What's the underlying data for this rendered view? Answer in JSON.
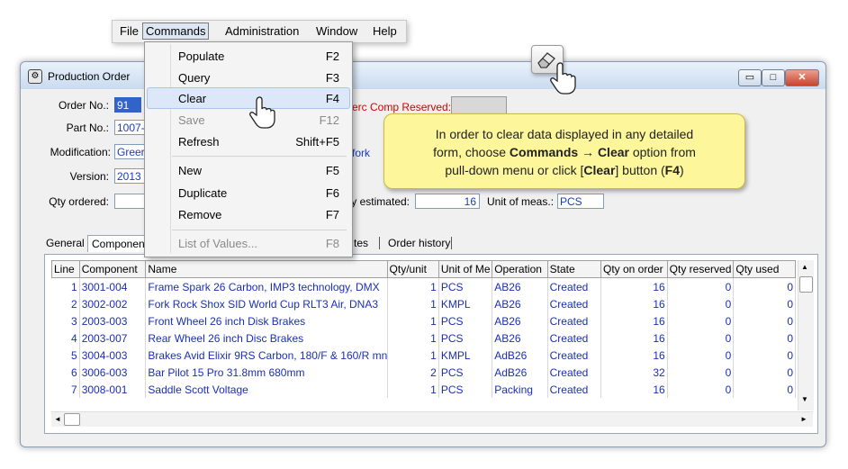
{
  "menubar": {
    "items": [
      "File",
      "Commands",
      "Administration",
      "Window",
      "Help"
    ],
    "active": "Commands"
  },
  "commands_menu": {
    "items": [
      {
        "label": "Populate",
        "shortcut": "F2",
        "enabled": true
      },
      {
        "label": "Query",
        "shortcut": "F3",
        "enabled": true
      },
      {
        "label": "Clear",
        "shortcut": "F4",
        "enabled": true,
        "highlighted": true
      },
      {
        "label": "Save",
        "shortcut": "F12",
        "enabled": false
      },
      {
        "label": "Refresh",
        "shortcut": "Shift+F5",
        "enabled": true
      },
      {
        "label": "New",
        "shortcut": "F5",
        "enabled": true
      },
      {
        "label": "Duplicate",
        "shortcut": "F6",
        "enabled": true
      },
      {
        "label": "Remove",
        "shortcut": "F7",
        "enabled": true
      },
      {
        "label": "List of Values...",
        "shortcut": "F8",
        "enabled": false
      }
    ]
  },
  "window": {
    "title": "Production Order",
    "min_glyph": "▭",
    "max_glyph": "□",
    "close_glyph": "✕"
  },
  "form": {
    "order_no_label": "Order No.:",
    "order_no_value": "91",
    "part_no_label": "Part No.:",
    "part_no_value": "1007-",
    "modification_label": "Modification:",
    "modification_value": "Greer",
    "version_label": "Version:",
    "version_value": "2013",
    "qty_ordered_label": "Qty ordered:",
    "qty_ordered_value": "",
    "perc_comp_label": "erc Comp Reserved:",
    "fork_value": "fork",
    "qty_estimated_label": "ty estimated:",
    "qty_estimated_value": "16",
    "unit_label": "Unit of meas.:",
    "unit_value": "PCS"
  },
  "tabs": [
    "General",
    "Componen",
    "tes",
    "Order history"
  ],
  "grid": {
    "columns": [
      "Line",
      "Component",
      "Name",
      "Qty/unit",
      "Unit of Me",
      "Operation",
      "State",
      "Qty on order",
      "Qty reserved",
      "Qty used"
    ],
    "rows": [
      [
        "1",
        "3001-004",
        "Frame Spark 26 Carbon, IMP3 technology, DMX",
        "1",
        "PCS",
        "AB26",
        "Created",
        "16",
        "0",
        "0"
      ],
      [
        "2",
        "3002-002",
        "Fork Rock Shox SID World Cup RLT3 Air, DNA3",
        "1",
        "KMPL",
        "AB26",
        "Created",
        "16",
        "0",
        "0"
      ],
      [
        "3",
        "2003-003",
        "Front Wheel 26 inch Disk Brakes",
        "1",
        "PCS",
        "AB26",
        "Created",
        "16",
        "0",
        "0"
      ],
      [
        "4",
        "2003-007",
        "Rear Wheel 26 inch Disc Brakes",
        "1",
        "PCS",
        "AB26",
        "Created",
        "16",
        "0",
        "0"
      ],
      [
        "5",
        "3004-003",
        "Brakes Avid Elixir 9RS Carbon, 180/F & 160/R mn",
        "1",
        "KMPL",
        "AdB26",
        "Created",
        "16",
        "0",
        "0"
      ],
      [
        "6",
        "3006-003",
        "Bar Pilot 15 Pro 31.8mm 680mm",
        "2",
        "PCS",
        "AdB26",
        "Created",
        "32",
        "0",
        "0"
      ],
      [
        "7",
        "3008-001",
        "Saddle Scott Voltage",
        "1",
        "PCS",
        "Packing",
        "Created",
        "16",
        "0",
        "0"
      ]
    ]
  },
  "callout": {
    "line1": "In order to clear data displayed in any detailed",
    "line2_pre": "form, choose ",
    "line2_cmd": "Commands",
    "line2_arrow": "→",
    "line2_clear": "Clear",
    "line2_post": " option from",
    "line3_pre": "pull-down menu or click [",
    "line3_btn": "Clear",
    "line3_mid": "] button (",
    "line3_key": "F4",
    "line3_post": ")"
  },
  "icons": {
    "eraser": "eraser-icon",
    "hand": "hand-pointer-icon",
    "scroll_up": "▲",
    "scroll_down": "▼",
    "scroll_left": "◄",
    "scroll_right": "►"
  }
}
